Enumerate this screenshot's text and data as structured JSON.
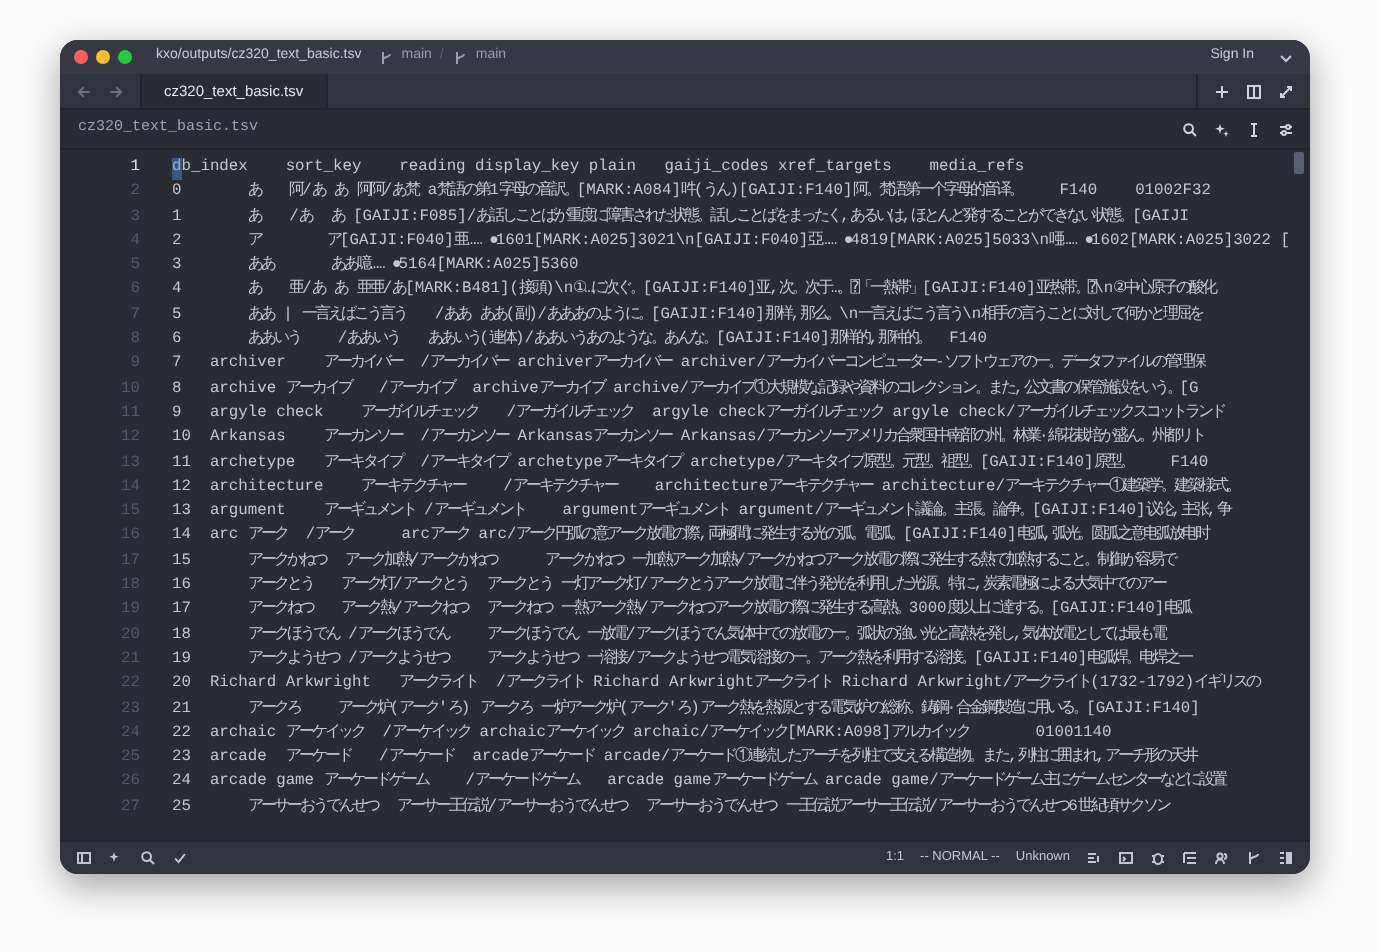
{
  "window": {
    "path": "kxo/outputs/cz320_text_basic.tsv",
    "branches": [
      "main",
      "main"
    ],
    "separator": "/",
    "account": "Sign In"
  },
  "tabs": [
    {
      "label": "cz320_text_basic.tsv",
      "selected": true
    }
  ],
  "file_header": {
    "title": "cz320_text_basic.tsv"
  },
  "lines": [
    {
      "number": "1",
      "text": "db_index    sort_key    reading display_key plain   gaiji_codes xref_targets    media_refs",
      "current": true
    },
    {
      "number": "2",
      "text": "0       あ   阿/あ あ 阿阿/あ梵 a梵語の第1字母の音訳。[MARK:A084]吽(うん)[GAIJI:F140]阿。梵语第一个字母的音译。    F140    01002F32",
      "current": false
    },
    {
      "number": "3",
      "text": "1       あ   /あ  あ [GAIJI:F085]/あ話しことばが重度に障害された状態。話しことばをまったく,あるいは,ほとんど発することができない状態。[GAIJI",
      "current": false
    },
    {
      "number": "4",
      "text": "2       ア       ア[GAIJI:F040]亜…… ●1601[MARK:A025]3021\\n[GAIJI:F040]亞…… ●4819[MARK:A025]5033\\n唖…… ●1602[MARK:A025]3022 [",
      "current": false
    },
    {
      "number": "5",
      "text": "3       ああ      ああ噫…… ●5164[MARK:A025]5360",
      "current": false
    },
    {
      "number": "6",
      "text": "4       あ   亜/あ あ 亜亜/あ[MARK:B481](接頭)\\n①…に次ぐ。[GAIJI:F140]亚,次。次于…。⍰「一熱帯」[GAIJI:F140]亚热带。⍰\\n②中心原子の酸化",
      "current": false
    },
    {
      "number": "7",
      "text": "5       ああ | 一言えばこう言う   /ああ ああ(副)/あああのように。[GAIJI:F140]那样,那么。\\n一言えばこう言う\\n相手の言うことに対して何かと理屈を",
      "current": false
    },
    {
      "number": "8",
      "text": "6       ああいう    /ああいう   ああいう(連体)/ああいうあのような。あんな。[GAIJI:F140]那样的,那种的。  F140",
      "current": false
    },
    {
      "number": "9",
      "text": "7   archiver    アーカイバー  /アーカイバー archiverアーカイバー archiver/アーカイバーコンピューター-ソフトウェアの一。データファイルの管理保",
      "current": false
    },
    {
      "number": "10",
      "text": "8   archive アーカイブ   /アーカイブ  archiveアーカイブ archive/アーカイブ①大規模な記録や資料のコレクション。また,公文書の保管施設をいう。[G",
      "current": false
    },
    {
      "number": "11",
      "text": "9   argyle check    アーガイルチェック   /アーガイルチェック  argyle checkアーガイルチェック argyle check/アーガイルチェックスコットランド",
      "current": false
    },
    {
      "number": "12",
      "text": "10  Arkansas    アーカンソー  /アーカンソー Arkansasアーカンソー Arkansas/アーカンソーアメリカ合衆国中南部の州。林業·綿花栽培が盛ん。州都リト",
      "current": false
    },
    {
      "number": "13",
      "text": "11  archetype   アーキタイプ  /アーキタイプ archetypeアーキタイプ archetype/アーキタイプ原型。元型。祖型。[GAIJI:F140]原型。    F140",
      "current": false
    },
    {
      "number": "14",
      "text": "12  architecture    アーキテクチャー    /アーキテクチャー    architectureアーキテクチャー architecture/アーキテクチャー①建築学。建築様式。",
      "current": false
    },
    {
      "number": "15",
      "text": "13  argument    アーギュメント /アーギュメント    argumentアーギュメント argument/アーギュメント議論。主張。論争。[GAIJI:F140]议论,主张,争",
      "current": false
    },
    {
      "number": "16",
      "text": "14  arc アーク  /アーク     arcアーク arc/アーク円弧の意アーク放電の際,両極間に発生する光の弧。電弧。[GAIJI:F140]电弧,弧光。圆弧之意电弧放电时",
      "current": false
    },
    {
      "number": "17",
      "text": "15      アークかねつ  アーク加熱/アークかねつ     アークかねつ 一加熱アーク加熱/アークかねつアーク放電の際に発生する熱で加熱すること。制御が容易で",
      "current": false
    },
    {
      "number": "18",
      "text": "16      アークとう   アーク灯/アークとう  アークとう 一灯アーク灯/アークとうアーク放電に伴う発光を利用した光源。特に,炭素電極による大気中でのアー",
      "current": false
    },
    {
      "number": "19",
      "text": "17      アークねつ   アーク熱/アークねつ  アークねつ 一熱アーク熱/アークねつアーク放電の際に発生する高熱。3000度以上に達する。[GAIJI:F140]电弧",
      "current": false
    },
    {
      "number": "20",
      "text": "18      アークほうでん /アークほうでん    アークほうでん 一放電/アークほうでん気体中での放電の一。弧状の強い光と高熱を発し,気体放電としては最も電",
      "current": false
    },
    {
      "number": "21",
      "text": "19      アークようせつ /アークようせつ    アークようせつ 一溶接/アークようせつ電気溶接の一。アーク熱を利用する溶接。[GAIJI:F140]电弧焊。电焊之一",
      "current": false
    },
    {
      "number": "22",
      "text": "20  Richard Arkwright   アークライト  /アークライト Richard Arkwrightアークライト Richard Arkwright/アークライト(1732-1792)イギリスの",
      "current": false
    },
    {
      "number": "23",
      "text": "21      アークろ    アーク炉(アーク'ろ) アークろ 一炉アーク炉(アーク'ろ)アーク熱を熱源とする電気炉の総称。鋳鋼·合金鋼製造に用いる。[GAIJI:F140]",
      "current": false
    },
    {
      "number": "24",
      "text": "22  archaic アーケイック  /アーケイック archaicアーケイック archaic/アーケイック[MARK:A098]アルカイック       01001140",
      "current": false
    },
    {
      "number": "25",
      "text": "23  arcade  アーケード   /アーケード  arcadeアーケード arcade/アーケード①連続したアーチを列柱で支える構造物。また,列柱に囲まれ,アーチ形の天井",
      "current": false
    },
    {
      "number": "26",
      "text": "24  arcade game アーケードゲーム    /アーケードゲーム   arcade gameアーケードゲーム arcade game/アーケードゲーム主にゲームセンターなどに設置",
      "current": false
    },
    {
      "number": "27",
      "text": "25      アーサーおうでんせつ  アーサー王伝説/アーサーおうでんせつ  アーサーおうでんせつ 一王伝説アーサー王伝説/アーサーおうでんせつ6世紀頃サクソン",
      "current": false
    }
  ],
  "status_bar": {
    "position": "1:1",
    "mode": "-- NORMAL --",
    "language": "Unknown"
  }
}
